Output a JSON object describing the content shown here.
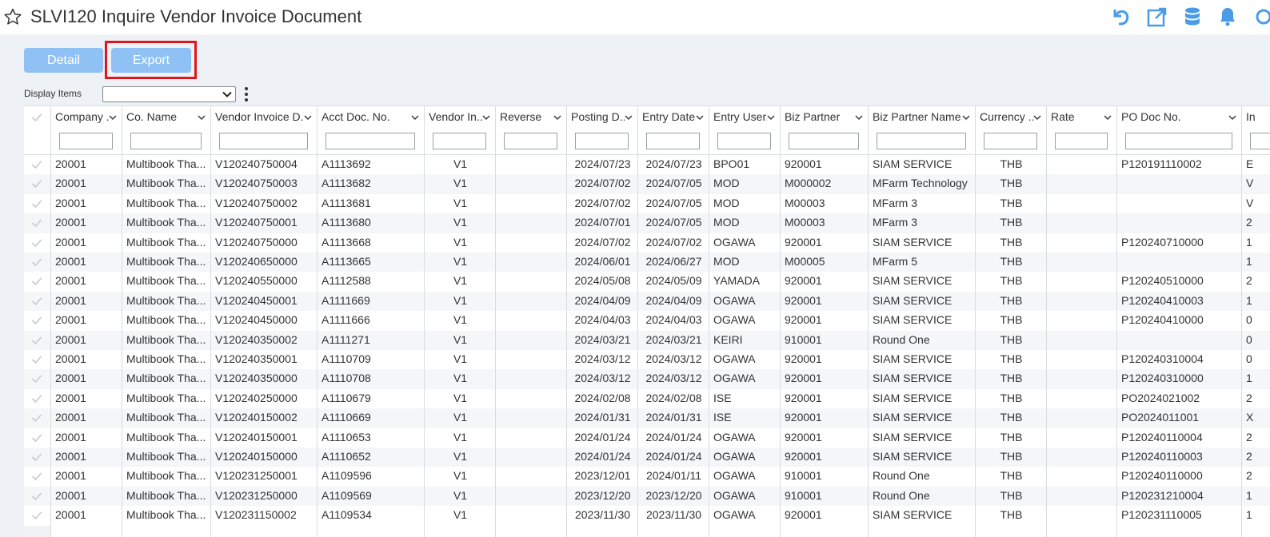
{
  "header": {
    "title": "SLVI120 Inquire Vendor Invoice Document"
  },
  "toolbar": {
    "detail_label": "Detail",
    "export_label": "Export"
  },
  "display_items": {
    "label": "Display Items",
    "value": ""
  },
  "columns": [
    "Company ...",
    "Co. Name",
    "Vendor Invoice D...",
    "Acct Doc. No.",
    "Vendor In...",
    "Reverse",
    "Posting D...",
    "Entry Date...",
    "Entry User...",
    "Biz Partner",
    "Biz Partner Name...",
    "Currency ...",
    "Rate",
    "PO Doc No.",
    "In"
  ],
  "rows": [
    [
      "20001",
      "Multibook Tha...",
      "V120240750004",
      "A1113692",
      "V1",
      "",
      "2024/07/23",
      "2024/07/23",
      "BPO01",
      "920001",
      "SIAM SERVICE",
      "THB",
      "",
      "P120191110002",
      "E"
    ],
    [
      "20001",
      "Multibook Tha...",
      "V120240750003",
      "A1113682",
      "V1",
      "",
      "2024/07/02",
      "2024/07/05",
      "MOD",
      "M000002",
      "MFarm Technology",
      "THB",
      "",
      "",
      "V"
    ],
    [
      "20001",
      "Multibook Tha...",
      "V120240750002",
      "A1113681",
      "V1",
      "",
      "2024/07/02",
      "2024/07/05",
      "MOD",
      "M00003",
      "MFarm 3",
      "THB",
      "",
      "",
      "V"
    ],
    [
      "20001",
      "Multibook Tha...",
      "V120240750001",
      "A1113680",
      "V1",
      "",
      "2024/07/01",
      "2024/07/05",
      "MOD",
      "M00003",
      "MFarm 3",
      "THB",
      "",
      "",
      "2"
    ],
    [
      "20001",
      "Multibook Tha...",
      "V120240750000",
      "A1113668",
      "V1",
      "",
      "2024/07/02",
      "2024/07/02",
      "OGAWA",
      "920001",
      "SIAM SERVICE",
      "THB",
      "",
      "P120240710000",
      "1"
    ],
    [
      "20001",
      "Multibook Tha...",
      "V120240650000",
      "A1113665",
      "V1",
      "",
      "2024/06/01",
      "2024/06/27",
      "MOD",
      "M00005",
      "MFarm 5",
      "THB",
      "",
      "",
      "1"
    ],
    [
      "20001",
      "Multibook Tha...",
      "V120240550000",
      "A1112588",
      "V1",
      "",
      "2024/05/08",
      "2024/05/09",
      "YAMADA",
      "920001",
      "SIAM SERVICE",
      "THB",
      "",
      "P120240510000",
      "2"
    ],
    [
      "20001",
      "Multibook Tha...",
      "V120240450001",
      "A1111669",
      "V1",
      "",
      "2024/04/09",
      "2024/04/09",
      "OGAWA",
      "920001",
      "SIAM SERVICE",
      "THB",
      "",
      "P120240410003",
      "1"
    ],
    [
      "20001",
      "Multibook Tha...",
      "V120240450000",
      "A1111666",
      "V1",
      "",
      "2024/04/03",
      "2024/04/03",
      "OGAWA",
      "920001",
      "SIAM SERVICE",
      "THB",
      "",
      "P120240410000",
      "0"
    ],
    [
      "20001",
      "Multibook Tha...",
      "V120240350002",
      "A1111271",
      "V1",
      "",
      "2024/03/21",
      "2024/03/21",
      "KEIRI",
      "910001",
      "Round One",
      "THB",
      "",
      "",
      "0"
    ],
    [
      "20001",
      "Multibook Tha...",
      "V120240350001",
      "A1110709",
      "V1",
      "",
      "2024/03/12",
      "2024/03/12",
      "OGAWA",
      "920001",
      "SIAM SERVICE",
      "THB",
      "",
      "P120240310004",
      "0"
    ],
    [
      "20001",
      "Multibook Tha...",
      "V120240350000",
      "A1110708",
      "V1",
      "",
      "2024/03/12",
      "2024/03/12",
      "OGAWA",
      "920001",
      "SIAM SERVICE",
      "THB",
      "",
      "P120240310000",
      "1"
    ],
    [
      "20001",
      "Multibook Tha...",
      "V120240250000",
      "A1110679",
      "V1",
      "",
      "2024/02/08",
      "2024/02/08",
      "ISE",
      "920001",
      "SIAM SERVICE",
      "THB",
      "",
      "PO2024021002",
      "2"
    ],
    [
      "20001",
      "Multibook Tha...",
      "V120240150002",
      "A1110669",
      "V1",
      "",
      "2024/01/31",
      "2024/01/31",
      "ISE",
      "920001",
      "SIAM SERVICE",
      "THB",
      "",
      "PO2024011001",
      "X"
    ],
    [
      "20001",
      "Multibook Tha...",
      "V120240150001",
      "A1110653",
      "V1",
      "",
      "2024/01/24",
      "2024/01/24",
      "OGAWA",
      "920001",
      "SIAM SERVICE",
      "THB",
      "",
      "P120240110004",
      "2"
    ],
    [
      "20001",
      "Multibook Tha...",
      "V120240150000",
      "A1110652",
      "V1",
      "",
      "2024/01/24",
      "2024/01/24",
      "OGAWA",
      "920001",
      "SIAM SERVICE",
      "THB",
      "",
      "P120240110003",
      "2"
    ],
    [
      "20001",
      "Multibook Tha...",
      "V120231250001",
      "A1109596",
      "V1",
      "",
      "2023/12/01",
      "2024/01/11",
      "OGAWA",
      "910001",
      "Round One",
      "THB",
      "",
      "P120240110000",
      "2"
    ],
    [
      "20001",
      "Multibook Tha...",
      "V120231250000",
      "A1109569",
      "V1",
      "",
      "2023/12/20",
      "2023/12/20",
      "OGAWA",
      "910001",
      "Round One",
      "THB",
      "",
      "P120231210004",
      "1"
    ],
    [
      "20001",
      "Multibook Tha...",
      "V120231150002",
      "A1109534",
      "V1",
      "",
      "2023/11/30",
      "2023/11/30",
      "OGAWA",
      "920001",
      "SIAM SERVICE",
      "THB",
      "",
      "P120231110005",
      "1"
    ]
  ],
  "colors": {
    "accent": "#4a9be8",
    "button": "#8fc1f4",
    "highlight": "#e0161d"
  }
}
